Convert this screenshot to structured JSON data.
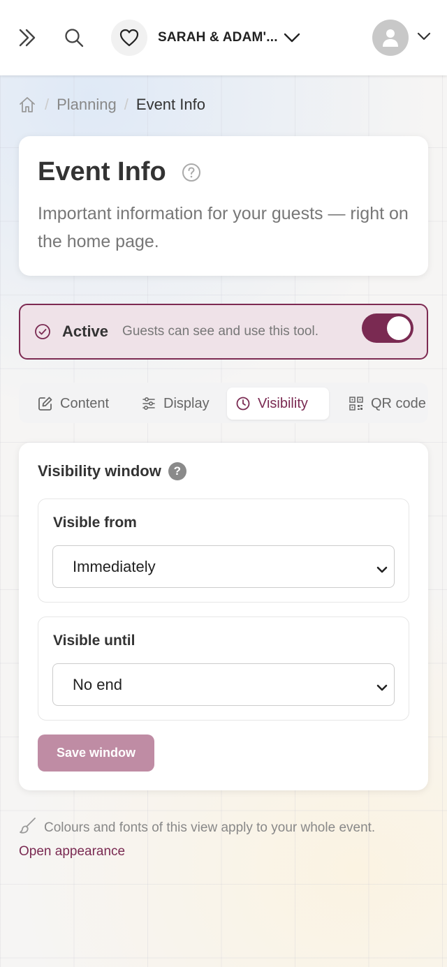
{
  "header": {
    "event_name": "SARAH & ADAM'...",
    "icons": {
      "expand": "double-chevron-right-icon",
      "search": "search-icon",
      "event": "heart-icon",
      "event_menu": "chevron-down-icon",
      "user": "user-icon",
      "user_menu": "chevron-down-icon"
    }
  },
  "breadcrumb": {
    "items": [
      "Planning",
      "Event Info"
    ],
    "separator": "/"
  },
  "page": {
    "title": "Event Info",
    "subtitle": "Important information for your guests — right on the home page."
  },
  "status": {
    "label": "Active",
    "description": "Guests can see and use this tool.",
    "enabled": true,
    "accent_color": "#7a2a52"
  },
  "tabs": [
    {
      "label": "Content",
      "icon": "edit-icon",
      "active": false
    },
    {
      "label": "Display",
      "icon": "sliders-icon",
      "active": false
    },
    {
      "label": "Visibility",
      "icon": "clock-icon",
      "active": true
    },
    {
      "label": "QR code",
      "icon": "qr-code-icon",
      "active": false
    }
  ],
  "visibility": {
    "title": "Visibility window",
    "help": "?",
    "from": {
      "label": "Visible from",
      "value": "Immediately"
    },
    "until": {
      "label": "Visible until",
      "value": "No end"
    },
    "save_label": "Save window"
  },
  "footer": {
    "note": "Colours and fonts of this view apply to your whole event.",
    "link": "Open appearance"
  }
}
